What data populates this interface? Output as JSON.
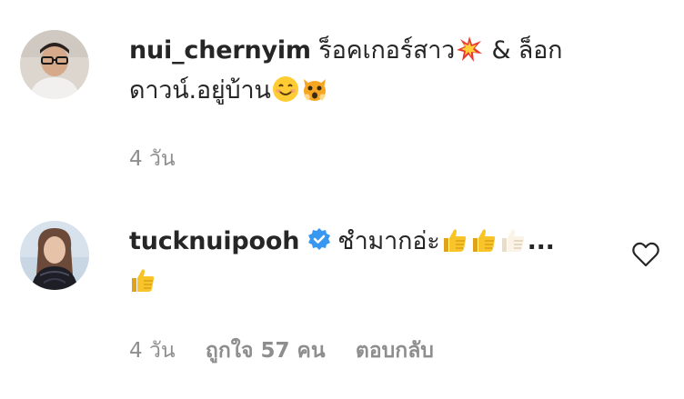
{
  "comments": [
    {
      "username": "nui_chernyim",
      "text_line1": "ร็อคเกอร์สาว",
      "text_line1b": " & ล็อก",
      "text_line2": "ดาวน์.อยู่บ้าน",
      "emojis": [
        "collision-emoji",
        "smiling-face-emoji",
        "weary-cat-emoji"
      ],
      "time": "4 วัน"
    },
    {
      "username": "tucknuipooh",
      "verified": true,
      "text": "ชำมากอ่ะ",
      "ellipsis": "...",
      "emojis": [
        "thumbs-up-emoji",
        "thumbs-up-emoji",
        "thumbs-up-light-emoji",
        "thumbs-up-emoji"
      ],
      "time": "4 วัน",
      "likes": "ถูกใจ 57 คน",
      "reply_label": "ตอบกลับ"
    }
  ],
  "colors": {
    "text": "#262626",
    "meta": "#8e8e8e",
    "verified": "#3897f0"
  },
  "icons": {
    "like": "heart-outline-icon",
    "verified": "verified-badge-icon"
  }
}
